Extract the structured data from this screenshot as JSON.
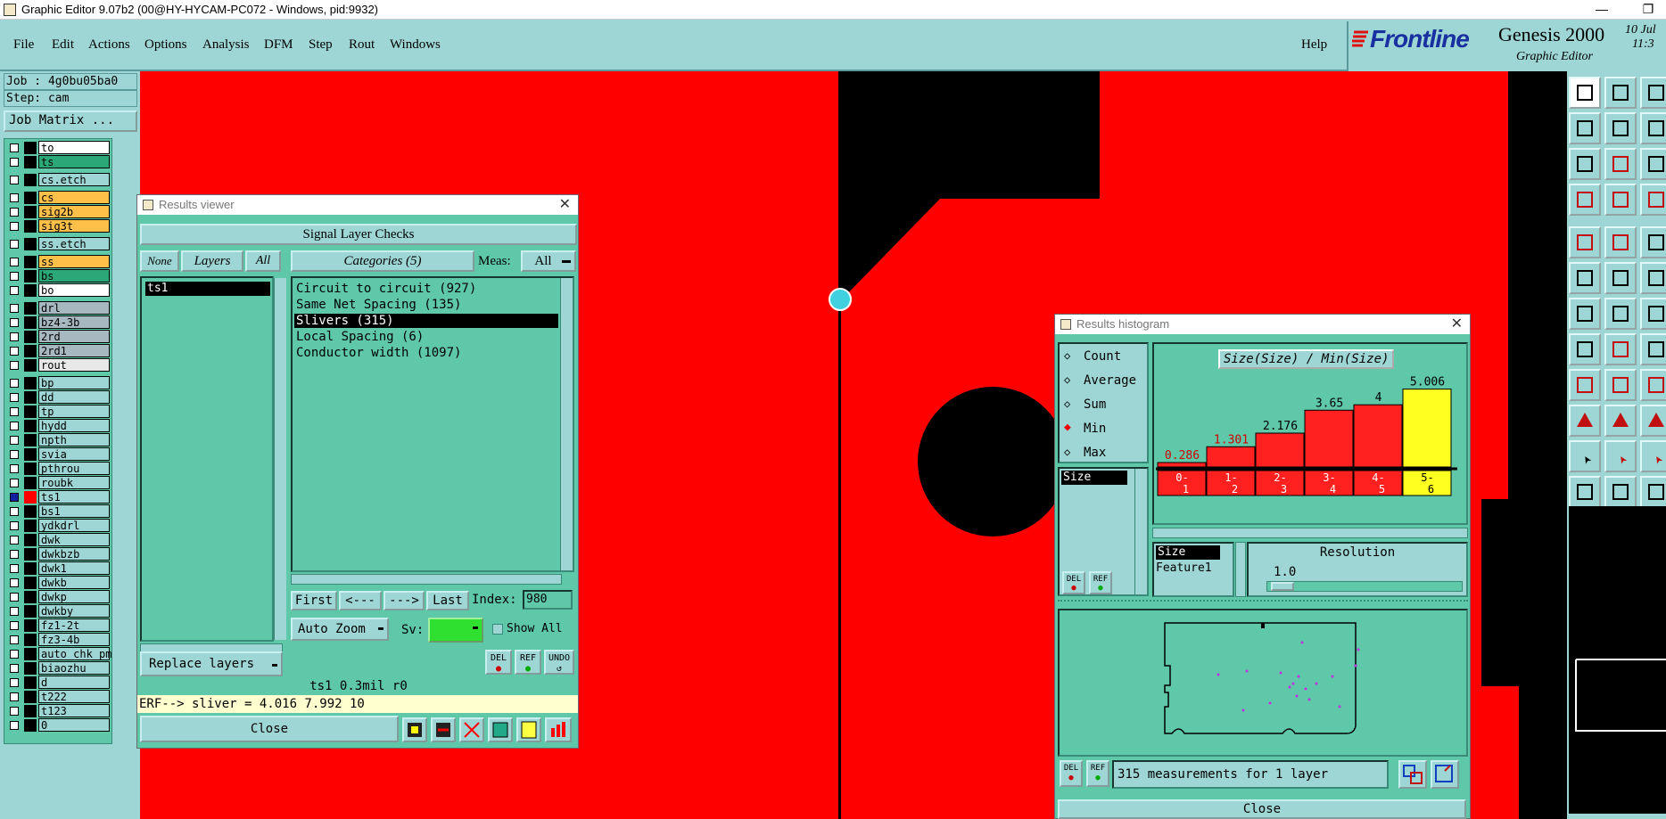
{
  "window": {
    "title": "Graphic Editor 9.07b2 (00@HY-HYCAM-PC072 - Windows, pid:9932)",
    "minimize": "—",
    "maximize": "❐"
  },
  "menu": {
    "items": [
      "File",
      "Edit",
      "Actions",
      "Options",
      "Analysis",
      "DFM",
      "Step",
      "Rout",
      "Windows"
    ],
    "help": "Help"
  },
  "brand": {
    "logo": "Frontline",
    "product": "Genesis 2000",
    "subtitle": "Graphic Editor",
    "date": "10 Jul",
    "time": "11:3"
  },
  "job": {
    "job_line": "Job : 4g0bu05ba0",
    "step_line": "Step: cam",
    "matrix_button": "Job Matrix ..."
  },
  "layers": [
    {
      "name": "to",
      "color": "#ffffff"
    },
    {
      "name": "ts",
      "color": "#2aa878"
    },
    {
      "name": "cs.etch",
      "color": "#9ed6d6"
    },
    {
      "name": "cs",
      "color": "#ffc04a"
    },
    {
      "name": "sig2b",
      "color": "#ffc04a"
    },
    {
      "name": "sig3t",
      "color": "#ffc04a"
    },
    {
      "name": "ss.etch",
      "color": "#9ed6d6"
    },
    {
      "name": "ss",
      "color": "#ffc04a"
    },
    {
      "name": "bs",
      "color": "#2aa878"
    },
    {
      "name": "bo",
      "color": "#ffffff"
    },
    {
      "name": "drl",
      "color": "#a8b8c0"
    },
    {
      "name": "bz4-3b",
      "color": "#a8b8c0"
    },
    {
      "name": "2rd",
      "color": "#a8b8c0"
    },
    {
      "name": "2rd1",
      "color": "#a8b8c0"
    },
    {
      "name": "rout",
      "color": "#e8e8e8"
    },
    {
      "name": "bp",
      "color": "#9ed6d6"
    },
    {
      "name": "dd",
      "color": "#9ed6d6"
    },
    {
      "name": "tp",
      "color": "#9ed6d6"
    },
    {
      "name": "hydd",
      "color": "#9ed6d6"
    },
    {
      "name": "npth",
      "color": "#9ed6d6"
    },
    {
      "name": "svia",
      "color": "#9ed6d6"
    },
    {
      "name": "pthrou",
      "color": "#9ed6d6"
    },
    {
      "name": "roubk",
      "color": "#9ed6d6"
    },
    {
      "name": "ts1",
      "color": "#9ed6d6"
    },
    {
      "name": "bs1",
      "color": "#9ed6d6"
    },
    {
      "name": "ydkdrl",
      "color": "#9ed6d6"
    },
    {
      "name": "dwk",
      "color": "#9ed6d6"
    },
    {
      "name": "dwkbzb",
      "color": "#9ed6d6"
    },
    {
      "name": "dwk1",
      "color": "#9ed6d6"
    },
    {
      "name": "dwkb",
      "color": "#9ed6d6"
    },
    {
      "name": "dwkp",
      "color": "#9ed6d6"
    },
    {
      "name": "dwkby",
      "color": "#9ed6d6"
    },
    {
      "name": "fz1-2t",
      "color": "#9ed6d6"
    },
    {
      "name": "fz3-4b",
      "color": "#9ed6d6"
    },
    {
      "name": "auto_chk_pm",
      "color": "#9ed6d6"
    },
    {
      "name": "biaozhu",
      "color": "#9ed6d6"
    },
    {
      "name": "d",
      "color": "#9ed6d6"
    },
    {
      "name": "t222",
      "color": "#9ed6d6"
    },
    {
      "name": "t123",
      "color": "#9ed6d6"
    },
    {
      "name": "0",
      "color": "#9ed6d6"
    }
  ],
  "results_viewer": {
    "title": "Results viewer",
    "header": "Signal Layer Checks",
    "btn_none": "None",
    "btn_layers": "Layers",
    "btn_all": "All",
    "layer_items": [
      "ts1"
    ],
    "categories_label": "Categories (5)",
    "meas_label": "Meas:",
    "meas_value": "All",
    "categories": [
      "Circuit to circuit (927)",
      "Same Net Spacing (135)",
      "Slivers (315)",
      "Local Spacing (6)",
      "Conductor width (1097)"
    ],
    "nav": {
      "first": "First",
      "prev": "<---",
      "next": "--->",
      "last": "Last",
      "index_label": "Index:",
      "index_value": "980"
    },
    "auto_zoom": "Auto Zoom",
    "sv_label": "Sv:",
    "show_all": "Show All",
    "replace_layers": "Replace layers",
    "btn_del": "DEL",
    "btn_ref": "REF",
    "btn_undo": "UNDO",
    "status": "ts1 0.3mil  r0",
    "erf": "ERF--> sliver = 4.016 7.992 10",
    "close": "Close"
  },
  "histogram": {
    "title": "Results histogram",
    "options": [
      "Count",
      "Average",
      "Sum",
      "Min",
      "Max"
    ],
    "selected_option": "Min",
    "chart_title": "Size(Size) / Min(Size)",
    "left_list": [
      "Size"
    ],
    "bottom_list": [
      "Size",
      "Feature1"
    ],
    "resolution_label": "Resolution",
    "resolution_value": "1.0",
    "measurements": "315 measurements for 1 layer",
    "close": "Close",
    "btn_del": "DEL",
    "btn_ref": "REF"
  },
  "chart_data": {
    "type": "bar",
    "title": "Size(Size) / Min(Size)",
    "categories": [
      "0-1",
      "1-2",
      "2-3",
      "3-4",
      "4-5",
      "5-6"
    ],
    "values": [
      0.286,
      1.301,
      2.176,
      3.65,
      4,
      5.006
    ],
    "value_labels": [
      "0.286",
      "1.301",
      "2.176",
      "3.65",
      "4",
      "5.006"
    ],
    "highlight_index": 5,
    "ylim": [
      0,
      5.5
    ],
    "colors": {
      "bar": "#ff2020",
      "highlight": "#ffff20",
      "label_low": "#d00000"
    }
  },
  "colors": {
    "teal": "#9ed6d6",
    "green": "#5ec8a8",
    "canvas_red": "#ff0000",
    "black": "#000000"
  }
}
